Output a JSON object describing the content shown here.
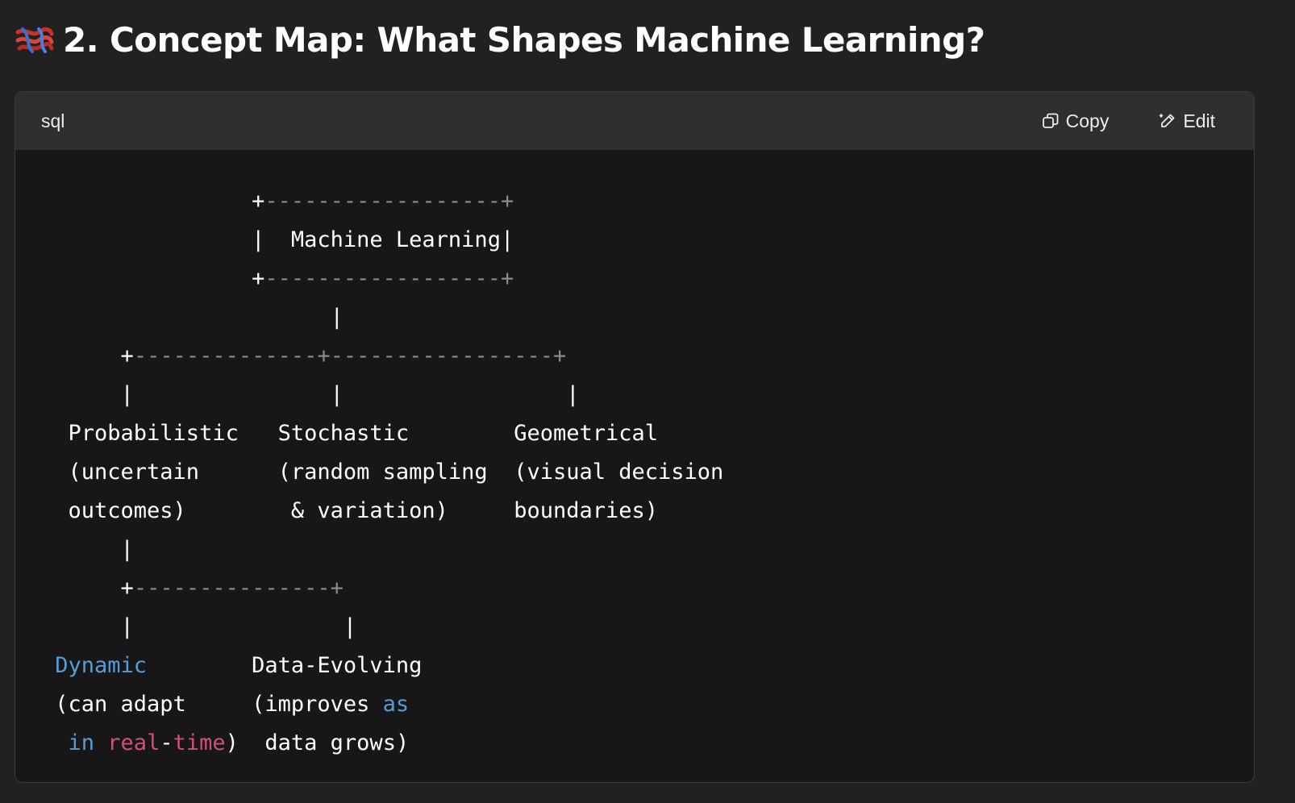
{
  "heading": {
    "title": "2. Concept Map: What Shapes Machine Learning?",
    "icon": "knot-emoji-icon"
  },
  "code_block": {
    "language": "sql",
    "copy_label": "Copy",
    "edit_label": "Edit",
    "lines": [
      [
        [
          "                ",
          "plain"
        ],
        [
          "+",
          "plain"
        ],
        [
          "------------------+",
          "dim"
        ]
      ],
      [
        [
          "                ",
          "plain"
        ],
        [
          "|  Machine Learning|",
          "plain"
        ]
      ],
      [
        [
          "                ",
          "plain"
        ],
        [
          "+",
          "plain"
        ],
        [
          "------------------+",
          "dim"
        ]
      ],
      [
        [
          "                      ",
          "plain"
        ],
        [
          "|",
          "plain"
        ]
      ],
      [
        [
          "      ",
          "plain"
        ],
        [
          "+",
          "plain"
        ],
        [
          "--------------+-----------------+",
          "dim"
        ]
      ],
      [
        [
          "      ",
          "plain"
        ],
        [
          "|",
          "plain"
        ],
        [
          "               |                 |",
          "plain"
        ]
      ],
      [
        [
          "  Probabilistic   Stochastic        Geometrical",
          "plain"
        ]
      ],
      [
        [
          "  (uncertain      (random sampling  (visual decision",
          "plain"
        ]
      ],
      [
        [
          "  outcomes)        & variation)     boundaries)",
          "plain"
        ]
      ],
      [
        [
          "      ",
          "plain"
        ],
        [
          "|",
          "plain"
        ]
      ],
      [
        [
          "      ",
          "plain"
        ],
        [
          "+",
          "plain"
        ],
        [
          "---------------+",
          "dim"
        ]
      ],
      [
        [
          "      |                ",
          "plain"
        ],
        [
          "|",
          "plain"
        ]
      ],
      [
        [
          " ",
          "plain"
        ],
        [
          "Dynamic",
          "kw"
        ],
        [
          "        Data-Evolving",
          "plain"
        ]
      ],
      [
        [
          " (can adapt     (improves ",
          "plain"
        ],
        [
          "as",
          "kw"
        ]
      ],
      [
        [
          "  ",
          "plain"
        ],
        [
          "in",
          "kw"
        ],
        [
          " ",
          "plain"
        ],
        [
          "real",
          "kw2"
        ],
        [
          "-",
          "plain"
        ],
        [
          "time",
          "kw2"
        ],
        [
          ")  data grows)",
          "plain"
        ]
      ]
    ]
  },
  "colors": {
    "page_bg": "#212121",
    "header_bg": "#2f2f2f",
    "code_bg": "#171717",
    "keyword_blue": "#569cd6",
    "keyword_pink": "#cf4f7b"
  }
}
